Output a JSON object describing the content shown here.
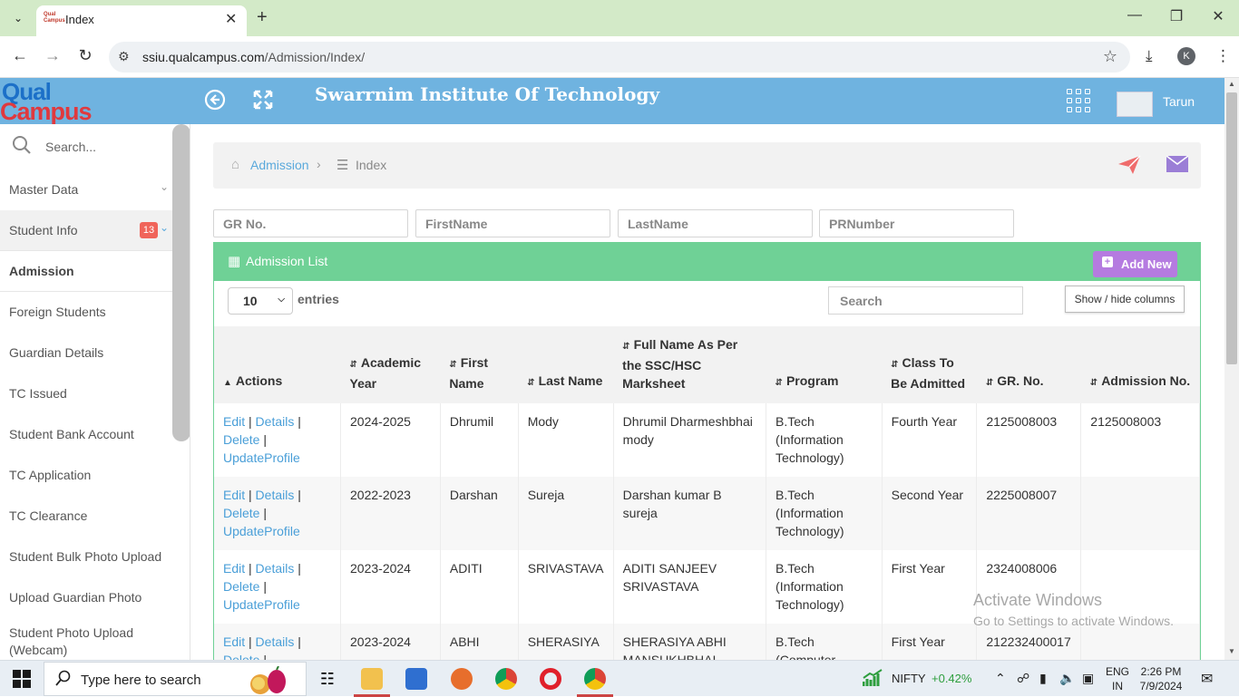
{
  "browser": {
    "tab_title": "Index",
    "favicon_text": "Qual Campus",
    "url_domain": "ssiu.qualcampus.com",
    "url_path": "/Admission/Index/",
    "profile_initial": "K"
  },
  "header": {
    "logo_top": "Qual",
    "logo_bottom": "Campus",
    "institute": "Swarrnim Institute Of Technology",
    "user": "Tarun"
  },
  "sidebar": {
    "search_placeholder": "Search...",
    "items": [
      {
        "label": "Master Data",
        "chevron": true
      },
      {
        "label": "Student Info",
        "badge": "13",
        "chevron": true
      },
      {
        "label": "Admission"
      },
      {
        "label": "Foreign Students"
      },
      {
        "label": "Guardian Details"
      },
      {
        "label": "TC Issued"
      },
      {
        "label": "Student Bank Account"
      },
      {
        "label": "TC Application"
      },
      {
        "label": "TC Clearance"
      },
      {
        "label": "Student Bulk Photo Upload"
      },
      {
        "label": "Upload Guardian Photo"
      },
      {
        "label": "Student Photo Upload (Webcam)"
      }
    ]
  },
  "breadcrumb": {
    "parent": "Admission",
    "current": "Index"
  },
  "filters": {
    "gr_no": "GR No.",
    "first_name": "FirstName",
    "last_name": "LastName",
    "pr_number": "PRNumber"
  },
  "list": {
    "title": "Admission List",
    "add_new": "Add New",
    "page_length": "10",
    "entries_label": "entries",
    "search_placeholder": "Search",
    "show_hide": "Show / hide columns",
    "columns": [
      "Actions",
      "Academic Year",
      "First Name",
      "Last Name",
      "Full Name As Per the SSC/HSC Marksheet",
      "Program",
      "Class To Be Admitted",
      "GR. No.",
      "Admission No."
    ],
    "action_links": {
      "edit": "Edit",
      "details": "Details",
      "delete": "Delete",
      "update": "UpdateProfile",
      "sep": "|"
    },
    "rows": [
      {
        "year": "2024-2025",
        "first": "Dhrumil",
        "last": "Mody",
        "full": "Dhrumil Dharmeshbhai mody",
        "program": "B.Tech (Information Technology)",
        "class": "Fourth Year",
        "gr": "2125008003",
        "adm": "2125008003"
      },
      {
        "year": "2022-2023",
        "first": "Darshan",
        "last": "Sureja",
        "full": "Darshan kumar B sureja",
        "program": "B.Tech (Information Technology)",
        "class": "Second Year",
        "gr": "2225008007",
        "adm": ""
      },
      {
        "year": "2023-2024",
        "first": "ADITI",
        "last": "SRIVASTAVA",
        "full": "ADITI SANJEEV SRIVASTAVA",
        "program": "B.Tech (Information Technology)",
        "class": "First Year",
        "gr": "2324008006",
        "adm": ""
      },
      {
        "year": "2023-2024",
        "first": "ABHI",
        "last": "SHERASIYA",
        "full": "SHERASIYA ABHI MANSUKHBHAI",
        "program": "B.Tech (Computer Engineering)",
        "class": "First Year",
        "gr": "212232400017",
        "adm": ""
      }
    ]
  },
  "watermark": {
    "line1": "Activate Windows",
    "line2": "Go to Settings to activate Windows."
  },
  "taskbar": {
    "search": "Type here to search",
    "nifty_label": "NIFTY",
    "nifty_value": "+0.42%",
    "lang1": "ENG",
    "lang2": "IN",
    "time": "2:26 PM",
    "date": "7/9/2024"
  }
}
